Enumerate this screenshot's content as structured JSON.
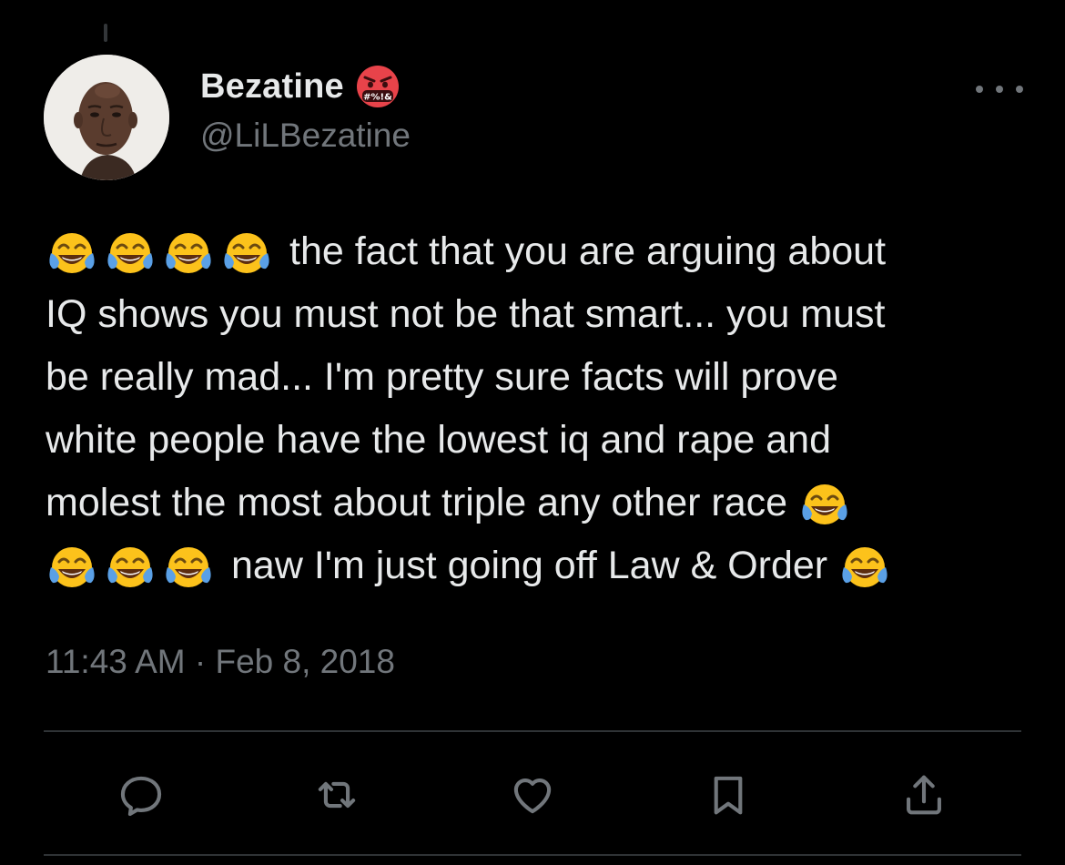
{
  "tweet": {
    "author": {
      "display_name": "Bezatine",
      "handle": "@LiLBezatine",
      "name_emoji": "face-with-symbols-on-mouth-icon",
      "avatar": "avatar-photo"
    },
    "text_lines": [
      "the fact that you are arguing about",
      "IQ shows you must not be that smart... you must",
      "be really mad... I'm pretty sure facts will prove",
      "white people have the lowest iq and rape and",
      "molest the most about triple any other race",
      "naw I'm just going off Law & Order"
    ],
    "emoji": "face-with-tears-of-joy-icon",
    "name_emoji_text": "#%!&",
    "timestamp": "11:43 AM · Feb 8, 2018"
  },
  "actions": {
    "reply": "reply-icon",
    "retweet": "retweet-icon",
    "like": "like-icon",
    "bookmark": "bookmark-icon",
    "share": "share-icon"
  },
  "colors": {
    "background": "#000000",
    "text_primary": "#e7e9ea",
    "text_secondary": "#71767b",
    "divider": "#2f3336",
    "emoji_face": "#fcc21b",
    "emoji_tears": "#5aa0e6",
    "angry_face": "#e8434a"
  }
}
